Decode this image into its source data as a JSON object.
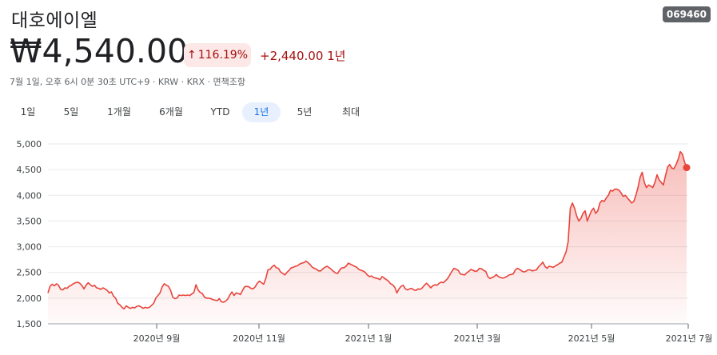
{
  "header": {
    "title": "대호에이엘",
    "ticker": "069460",
    "price": "₩4,540.00",
    "change_percent": "116.19%",
    "change_abs": "+2,440.00 1년",
    "meta": "7월 1일, 오후 6시 0분 30초 UTC+9 · KRW · KRX · 면책조항",
    "colors": {
      "down_red": "#a50e0e",
      "badge_bg": "#fce8e6",
      "line": "#e8453c"
    }
  },
  "tabs": [
    {
      "label": "1일",
      "active": false
    },
    {
      "label": "5일",
      "active": false
    },
    {
      "label": "1개월",
      "active": false
    },
    {
      "label": "6개월",
      "active": false
    },
    {
      "label": "YTD",
      "active": false
    },
    {
      "label": "1년",
      "active": true
    },
    {
      "label": "5년",
      "active": false
    },
    {
      "label": "최대",
      "active": false
    }
  ],
  "chart_data": {
    "type": "area",
    "x_axis_labels": [
      "2020년 9월",
      "2020년 11월",
      "2021년 1월",
      "2021년 3월",
      "2021년 5월",
      "2021년 7월"
    ],
    "y_ticks": [
      "5,000",
      "4,500",
      "4,000",
      "3,500",
      "3,000",
      "2,500",
      "2,000",
      "1,500"
    ],
    "ylim": [
      1500,
      5000
    ],
    "grid": true,
    "series": [
      {
        "values": [
          2100,
          2230,
          2270,
          2240,
          2280,
          2250,
          2170,
          2160,
          2200,
          2190,
          2230,
          2250,
          2280,
          2300,
          2310,
          2290,
          2250,
          2180,
          2250,
          2300,
          2260,
          2230,
          2250,
          2200,
          2190,
          2170,
          2200,
          2180,
          2150,
          2100,
          2120,
          2040,
          2000,
          1900,
          1870,
          1820,
          1790,
          1850,
          1820,
          1800,
          1820,
          1810,
          1840,
          1850,
          1830,
          1800,
          1820,
          1810,
          1820,
          1860,
          1900,
          2000,
          2050,
          2100,
          2220,
          2280,
          2250,
          2230,
          2150,
          2020,
          1990,
          2000,
          2060,
          2050,
          2060,
          2050,
          2060,
          2050,
          2080,
          2110,
          2260,
          2160,
          2110,
          2090,
          2020,
          2000,
          2000,
          1990,
          1970,
          1960,
          1950,
          1990,
          1930,
          1920,
          1940,
          1980,
          2060,
          2120,
          2050,
          2100,
          2090,
          2070,
          2150,
          2220,
          2230,
          2220,
          2190,
          2180,
          2220,
          2290,
          2330,
          2300,
          2270,
          2380,
          2550,
          2560,
          2610,
          2640,
          2590,
          2580,
          2510,
          2480,
          2450,
          2500,
          2540,
          2590,
          2600,
          2620,
          2630,
          2660,
          2680,
          2690,
          2720,
          2690,
          2650,
          2600,
          2580,
          2560,
          2530,
          2530,
          2570,
          2600,
          2620,
          2590,
          2560,
          2520,
          2490,
          2480,
          2550,
          2590,
          2590,
          2620,
          2680,
          2660,
          2640,
          2620,
          2600,
          2560,
          2540,
          2530,
          2500,
          2450,
          2420,
          2430,
          2400,
          2390,
          2380,
          2360,
          2420,
          2390,
          2360,
          2330,
          2280,
          2260,
          2210,
          2100,
          2180,
          2230,
          2250,
          2180,
          2160,
          2180,
          2190,
          2160,
          2150,
          2180,
          2170,
          2200,
          2250,
          2290,
          2250,
          2200,
          2240,
          2260,
          2250,
          2290,
          2310,
          2300,
          2340,
          2380,
          2450,
          2520,
          2580,
          2560,
          2540,
          2470,
          2460,
          2450,
          2490,
          2520,
          2560,
          2540,
          2520,
          2530,
          2580,
          2570,
          2540,
          2520,
          2420,
          2380,
          2400,
          2420,
          2460,
          2420,
          2400,
          2390,
          2400,
          2420,
          2450,
          2460,
          2470,
          2550,
          2580,
          2560,
          2530,
          2510,
          2520,
          2550,
          2550,
          2530,
          2540,
          2550,
          2610,
          2650,
          2700,
          2620,
          2580,
          2620,
          2610,
          2600,
          2630,
          2650,
          2680,
          2700,
          2800,
          2900,
          3100,
          3750,
          3850,
          3750,
          3600,
          3500,
          3550,
          3650,
          3700,
          3500,
          3600,
          3700,
          3750,
          3650,
          3700,
          3850,
          3900,
          3880,
          3950,
          4000,
          4100,
          4080,
          4120,
          4120,
          4100,
          4050,
          3980,
          4000,
          3950,
          3900,
          3850,
          3880,
          4000,
          4150,
          4350,
          4450,
          4250,
          4150,
          4200,
          4180,
          4150,
          4250,
          4400,
          4300,
          4250,
          4200,
          4380,
          4550,
          4600,
          4530,
          4520,
          4600,
          4700,
          4850,
          4800,
          4650,
          4540
        ]
      }
    ],
    "last_value": 4540
  }
}
